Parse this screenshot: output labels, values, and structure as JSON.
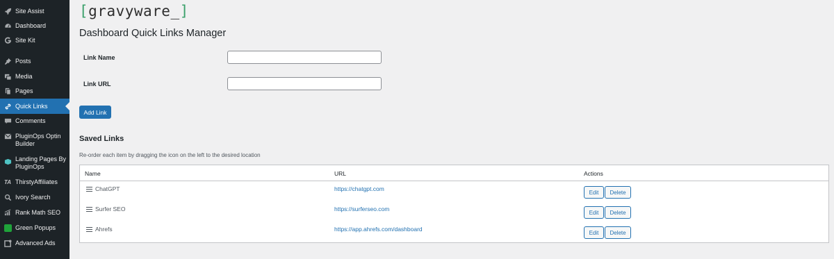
{
  "sidebar": {
    "items": [
      {
        "label": "Site Assist",
        "icon": "rocket-icon"
      },
      {
        "label": "Dashboard",
        "icon": "dashboard-icon"
      },
      {
        "label": "Site Kit",
        "icon": "google-g-icon"
      },
      {
        "label": "Posts",
        "icon": "pin-icon"
      },
      {
        "label": "Media",
        "icon": "media-icon"
      },
      {
        "label": "Pages",
        "icon": "pages-icon"
      },
      {
        "label": "Quick Links",
        "icon": "link-icon",
        "active": true
      },
      {
        "label": "Comments",
        "icon": "comment-icon"
      },
      {
        "label": "PluginOps Optin Builder",
        "icon": "email-icon"
      },
      {
        "label": "Landing Pages By PluginOps",
        "icon": "landing-pages-icon"
      },
      {
        "label": "ThirstyAffiliates",
        "icon": "ta-icon"
      },
      {
        "label": "Ivory Search",
        "icon": "search-icon"
      },
      {
        "label": "Rank Math SEO",
        "icon": "rank-math-icon"
      },
      {
        "label": "Green Popups",
        "icon": "green-popups-icon"
      },
      {
        "label": "Advanced Ads",
        "icon": "advanced-ads-icon"
      }
    ]
  },
  "header": {
    "logo_text": "gravyware_",
    "title": "Dashboard Quick Links Manager"
  },
  "form": {
    "name_label": "Link Name",
    "name_value": "",
    "url_label": "Link URL",
    "url_value": "",
    "add_button": "Add Link"
  },
  "saved": {
    "title": "Saved Links",
    "help_text": "Re-order each item by dragging the icon on the left to the desired location",
    "columns": {
      "name": "Name",
      "url": "URL",
      "actions": "Actions"
    },
    "edit_label": "Edit",
    "delete_label": "Delete",
    "rows": [
      {
        "name": "ChatGPT",
        "url": "https://chatgpt.com"
      },
      {
        "name": "Surfer SEO",
        "url": "https://surferseo.com"
      },
      {
        "name": "Ahrefs",
        "url": "https://app.ahrefs.com/dashboard"
      }
    ]
  },
  "colors": {
    "sidebar_bg": "#1d2327",
    "accent": "#2271b1",
    "page_bg": "#f0f0f1"
  }
}
